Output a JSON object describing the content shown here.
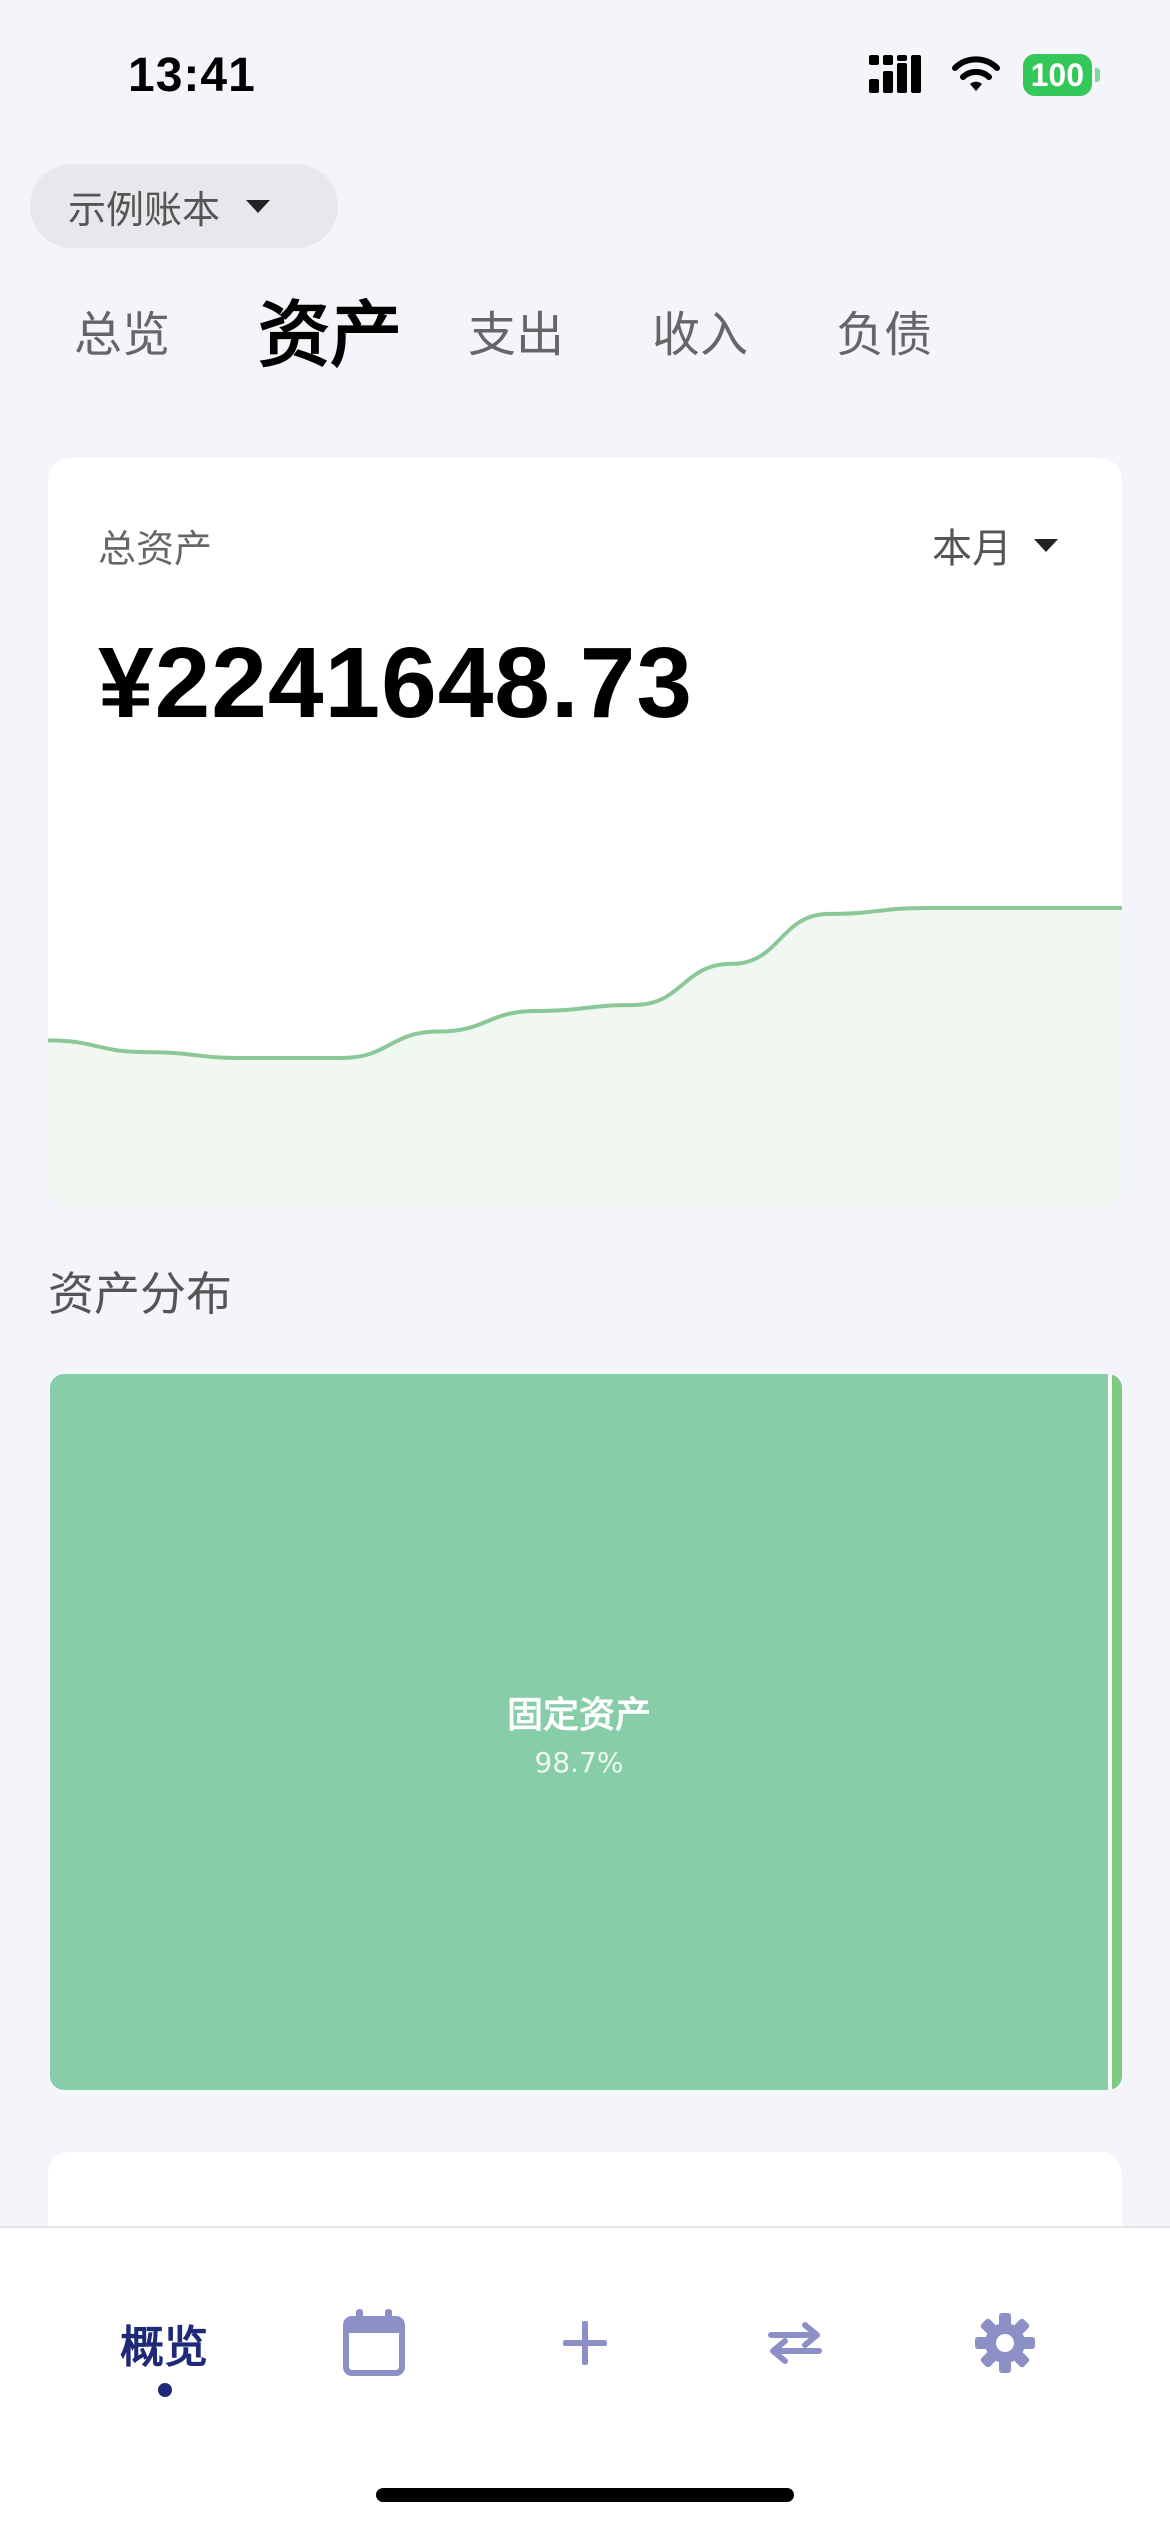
{
  "status_bar": {
    "time": "13:41",
    "battery": "100"
  },
  "ledger_selector": {
    "label": "示例账本"
  },
  "tabs": [
    {
      "label": "总览",
      "active": false
    },
    {
      "label": "资产",
      "active": true
    },
    {
      "label": "支出",
      "active": false
    },
    {
      "label": "收入",
      "active": false
    },
    {
      "label": "负债",
      "active": false
    }
  ],
  "asset_card": {
    "title": "总资产",
    "period": "本月",
    "amount": "¥2241648.73"
  },
  "trend_chart": {
    "type": "area",
    "line_color": "#8cc79a",
    "fill_color": "#f1f8f2",
    "values": [
      100.0,
      99.6,
      99.4,
      99.4,
      100.3,
      101.0,
      101.2,
      102.6,
      104.3,
      104.5,
      104.5,
      104.5
    ]
  },
  "distribution": {
    "title": "资产分布",
    "items": [
      {
        "label": "固定资产",
        "percent": "98.7%",
        "color": "#86cda8"
      },
      {
        "label": "",
        "percent": "",
        "color": "#7ccb80"
      }
    ]
  },
  "tabbar": {
    "home_label": "概览",
    "icons": [
      "calendar-icon",
      "plus-icon",
      "transfer-icon",
      "gear-icon"
    ],
    "active_color": "#1e2a78",
    "inactive_color": "#8d8fc7"
  }
}
